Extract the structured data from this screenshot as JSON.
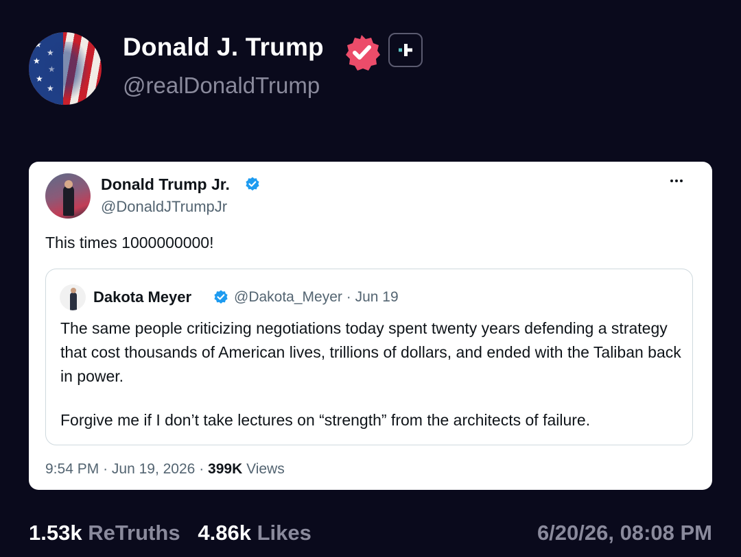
{
  "post": {
    "author_name": "Donald J. Trump",
    "author_handle": "@realDonaldTrump"
  },
  "embedded_tweet": {
    "author_name": "Donald Trump Jr.",
    "author_handle": "@DonaldJTrumpJr",
    "text": "This times 1000000000!",
    "quoted": {
      "author_name": "Dakota Meyer",
      "author_handle": "@Dakota_Meyer",
      "separator": "·",
      "date": "Jun 19",
      "paragraph_1": "The same people criticizing negotiations today spent twenty years defending a strategy that cost thousands of American lives, trillions of dollars, and ended with the Taliban back in power.",
      "paragraph_2": "Forgive me if I don’t take lectures on “strength” from the architects of failure."
    },
    "time": "9:54 PM",
    "date": "Jun 19, 2026",
    "views_count": "399K",
    "views_label": "Views"
  },
  "stats": {
    "retruths_count": "1.53k",
    "retruths_label": "ReTruths",
    "likes_count": "4.86k",
    "likes_label": "Likes"
  },
  "posted_at": "6/20/26, 08:08 PM",
  "colors": {
    "background": "#0a0a1c",
    "verified_badge_pink": "#ec4c6a",
    "verified_badge_blue": "#1d9bf0",
    "follow_accent": "#5cc6c6"
  },
  "icons": {
    "verified_main": "verified-badge-icon",
    "follow": "plus-icon",
    "card_verified": "verified-check-icon",
    "more": "more-dots-icon"
  }
}
